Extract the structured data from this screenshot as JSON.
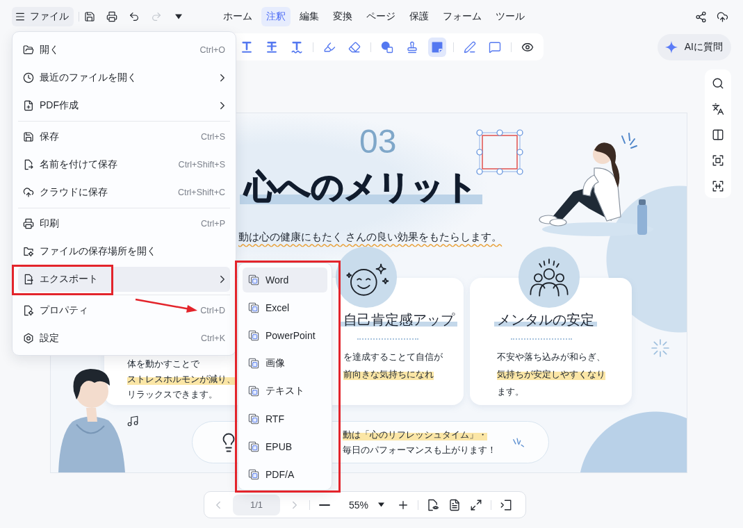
{
  "header": {
    "file_button": {
      "label": "ファイル",
      "open": true
    },
    "quick_actions": [
      {
        "kind": "save",
        "disabled": false
      },
      {
        "kind": "print",
        "disabled": false
      },
      {
        "kind": "undo",
        "disabled": false
      },
      {
        "kind": "redo",
        "disabled": true
      },
      {
        "kind": "more",
        "disabled": false
      }
    ],
    "tabs": [
      {
        "label": "ホーム",
        "selected": false
      },
      {
        "label": "注釈",
        "selected": true
      },
      {
        "label": "編集",
        "selected": false
      },
      {
        "label": "変換",
        "selected": false
      },
      {
        "label": "ページ",
        "selected": false
      },
      {
        "label": "保護",
        "selected": false
      },
      {
        "label": "フォーム",
        "selected": false
      },
      {
        "label": "ツール",
        "selected": false
      }
    ],
    "actions": [
      {
        "kind": "share"
      },
      {
        "kind": "upload"
      }
    ]
  },
  "annotation_toolbar": {
    "groups": [
      {
        "tools": [
          {
            "kind": "underline",
            "selected": false
          },
          {
            "kind": "strikethrough",
            "selected": false
          },
          {
            "kind": "squiggly",
            "selected": false
          }
        ]
      },
      {
        "tools": [
          {
            "kind": "highlight",
            "selected": false
          },
          {
            "kind": "eraser",
            "selected": false
          }
        ]
      },
      {
        "tools": [
          {
            "kind": "shape",
            "selected": false
          },
          {
            "kind": "stamp",
            "selected": false
          },
          {
            "kind": "area",
            "selected": true
          }
        ]
      },
      {
        "tools": [
          {
            "kind": "sign",
            "selected": false
          },
          {
            "kind": "comment",
            "selected": false
          }
        ]
      },
      {
        "tools": [
          {
            "kind": "view",
            "selected": false
          }
        ]
      }
    ]
  },
  "ai_button": {
    "label": "AIに質問"
  },
  "side_panel": {
    "tools": [
      {
        "kind": "search"
      },
      {
        "kind": "translate"
      },
      {
        "kind": "compare"
      },
      {
        "kind": "scan"
      },
      {
        "kind": "ocr"
      }
    ]
  },
  "document": {
    "number": "03",
    "title": "心へのメリット",
    "shape": {
      "selected": true
    },
    "subtitle": "動は心の健康にもたく さんの良い効果をもたらします。",
    "flagged": true,
    "cards": [
      {
        "kind": "plain",
        "lines": [
          {
            "text": "体を動かすことで",
            "highlighted": false
          },
          {
            "text": "ストレスホルモンが減り、",
            "highlighted": true
          },
          {
            "text": "リラックスできます。",
            "highlighted": false
          }
        ]
      },
      {
        "kind": "smiley",
        "heading": "自己肯定感アップ",
        "lines": [
          {
            "text": "を達成することて自信が",
            "highlighted": false
          },
          {
            "text": "前向きな気持ちになれ",
            "highlighted": true
          }
        ]
      },
      {
        "kind": "people",
        "heading": "メンタルの安定",
        "lines": [
          {
            "text": "不安や落ち込みが和らぎ、",
            "highlighted": false
          },
          {
            "text": "気持ちが安定しやすくなり",
            "highlighted": true
          },
          {
            "text": "ます。",
            "highlighted": false
          }
        ]
      }
    ],
    "tip": {
      "lines": [
        {
          "text": "動は「心のリフレッシュタイム」・",
          "highlighted": true
        },
        {
          "text": "毎日のパフォーマンスも上がります！",
          "highlighted": false
        }
      ]
    }
  },
  "page_bar": {
    "prev": {
      "disabled": true
    },
    "page": "1/1",
    "next": {
      "disabled": true
    },
    "zoom": "55%",
    "tool_groups": [
      {
        "tools": [
          {
            "kind": "read"
          },
          {
            "kind": "layout"
          },
          {
            "kind": "fit"
          }
        ]
      },
      {
        "tools": [
          {
            "kind": "collapse"
          }
        ]
      }
    ]
  },
  "file_menu": {
    "groups": [
      {
        "items": [
          {
            "kind": "open",
            "label": "開く",
            "shortcut": "Ctrl+O",
            "submenu": false,
            "selected": false
          },
          {
            "kind": "recent",
            "label": "最近のファイルを開く",
            "submenu": true,
            "selected": false
          },
          {
            "kind": "create",
            "label": "PDF作成",
            "submenu": true,
            "selected": false
          }
        ]
      },
      {
        "items": [
          {
            "kind": "save",
            "label": "保存",
            "shortcut": "Ctrl+S",
            "submenu": false,
            "selected": false
          },
          {
            "kind": "save-as",
            "label": "名前を付けて保存",
            "shortcut": "Ctrl+Shift+S",
            "submenu": false,
            "selected": false
          },
          {
            "kind": "cloud",
            "label": "クラウドに保存",
            "shortcut": "Ctrl+Shift+C",
            "submenu": false,
            "selected": false
          }
        ]
      },
      {
        "items": [
          {
            "kind": "print",
            "label": "印刷",
            "shortcut": "Ctrl+P",
            "submenu": false,
            "selected": false
          },
          {
            "kind": "location",
            "label": "ファイルの保存場所を開く",
            "submenu": false,
            "selected": false
          },
          {
            "kind": "export",
            "label": "エクスポート",
            "submenu": true,
            "selected": true
          }
        ]
      },
      {
        "items": [
          {
            "kind": "properties",
            "label": "プロパティ",
            "shortcut": "Ctrl+D",
            "submenu": false,
            "selected": false
          },
          {
            "kind": "settings",
            "label": "設定",
            "shortcut": "Ctrl+K",
            "submenu": false,
            "selected": false
          }
        ]
      }
    ]
  },
  "export_submenu": {
    "items": [
      {
        "label": "Word",
        "selected": true
      },
      {
        "label": "Excel",
        "selected": false
      },
      {
        "label": "PowerPoint",
        "selected": false
      },
      {
        "label": "画像",
        "selected": false
      },
      {
        "label": "テキスト",
        "selected": false
      },
      {
        "label": "RTF",
        "selected": false
      },
      {
        "label": "EPUB",
        "selected": false
      },
      {
        "label": "PDF/A",
        "selected": false
      }
    ]
  },
  "markup": [
    {
      "kind": "export-frame"
    },
    {
      "kind": "submenu-frame"
    },
    {
      "kind": "arrow"
    }
  ]
}
